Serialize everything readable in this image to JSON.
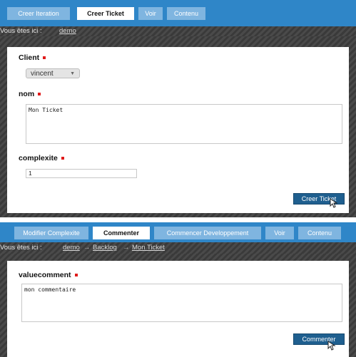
{
  "panel1": {
    "tabs": [
      {
        "label": "Creer Iteration",
        "active": false
      },
      {
        "label": "Creer Ticket",
        "active": true
      },
      {
        "label": "Voir",
        "active": false
      },
      {
        "label": "Contenu",
        "active": false
      }
    ],
    "breadcrumb": {
      "prefix": "Vous êtes ici :",
      "links": [
        "demo"
      ]
    },
    "form": {
      "client_label": "Client",
      "client_value": "vincent",
      "nom_label": "nom",
      "nom_value": "Mon Ticket",
      "complexite_label": "complexite",
      "complexite_value": "1",
      "submit_label": "Creer Ticket"
    }
  },
  "panel2": {
    "tabs": [
      {
        "label": "Modifier Complexite",
        "active": false
      },
      {
        "label": "Commenter",
        "active": true
      },
      {
        "label": "Commencer Developpement",
        "active": false
      },
      {
        "label": "Voir",
        "active": false
      },
      {
        "label": "Contenu",
        "active": false
      }
    ],
    "breadcrumb": {
      "prefix": "Vous êtes ici :",
      "links": [
        "demo",
        "Backlog",
        "Mon Ticket"
      ],
      "separator": "→"
    },
    "form": {
      "comment_label": "valuecomment",
      "comment_value": "mon commentaire",
      "submit_label": "Commenter"
    }
  },
  "colors": {
    "navbar": "#2f86c8",
    "tab_inactive": "#7fb5e0",
    "button": "#1f5f8f",
    "required_marker": "#e01b1b"
  },
  "icons": [
    "select-chevron-icon",
    "mouse-pointer-icon"
  ]
}
